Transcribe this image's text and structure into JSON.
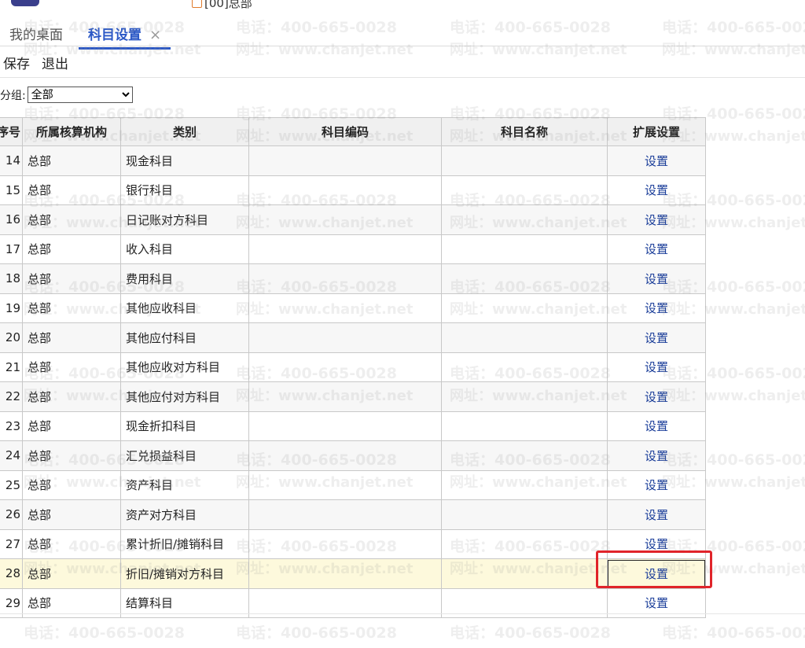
{
  "header": {
    "org_label": "[00]总部"
  },
  "tabs": [
    {
      "label": "我的桌面"
    },
    {
      "label": "科目设置",
      "close": "×"
    }
  ],
  "toolbar": {
    "save": "保存",
    "exit": "退出"
  },
  "filter": {
    "label": "分组:",
    "selected": "全部"
  },
  "table": {
    "columns": [
      "序号",
      "所属核算机构",
      "类别",
      "科目编码",
      "科目名称",
      "扩展设置"
    ],
    "rows": [
      {
        "no": "14",
        "org": "总部",
        "type": "现金科目",
        "code": "",
        "name": "",
        "action": "设置"
      },
      {
        "no": "15",
        "org": "总部",
        "type": "银行科目",
        "code": "",
        "name": "",
        "action": "设置"
      },
      {
        "no": "16",
        "org": "总部",
        "type": "日记账对方科目",
        "code": "",
        "name": "",
        "action": "设置"
      },
      {
        "no": "17",
        "org": "总部",
        "type": "收入科目",
        "code": "",
        "name": "",
        "action": "设置"
      },
      {
        "no": "18",
        "org": "总部",
        "type": "费用科目",
        "code": "",
        "name": "",
        "action": "设置"
      },
      {
        "no": "19",
        "org": "总部",
        "type": "其他应收科目",
        "code": "",
        "name": "",
        "action": "设置"
      },
      {
        "no": "20",
        "org": "总部",
        "type": "其他应付科目",
        "code": "",
        "name": "",
        "action": "设置"
      },
      {
        "no": "21",
        "org": "总部",
        "type": "其他应收对方科目",
        "code": "",
        "name": "",
        "action": "设置"
      },
      {
        "no": "22",
        "org": "总部",
        "type": "其他应付对方科目",
        "code": "",
        "name": "",
        "action": "设置"
      },
      {
        "no": "23",
        "org": "总部",
        "type": "现金折扣科目",
        "code": "",
        "name": "",
        "action": "设置"
      },
      {
        "no": "24",
        "org": "总部",
        "type": "汇兑损益科目",
        "code": "",
        "name": "",
        "action": "设置"
      },
      {
        "no": "25",
        "org": "总部",
        "type": "资产科目",
        "code": "",
        "name": "",
        "action": "设置"
      },
      {
        "no": "26",
        "org": "总部",
        "type": "资产对方科目",
        "code": "",
        "name": "",
        "action": "设置"
      },
      {
        "no": "27",
        "org": "总部",
        "type": "累计折旧/摊销科目",
        "code": "",
        "name": "",
        "action": "设置"
      },
      {
        "no": "28",
        "org": "总部",
        "type": "折旧/摊销对方科目",
        "code": "",
        "name": "",
        "action": "设置"
      },
      {
        "no": "29",
        "org": "总部",
        "type": "结算科目",
        "code": "",
        "name": "",
        "action": "设置"
      }
    ]
  },
  "watermark": {
    "phone": "电话：400-665-0028",
    "site": "网址：www.chanjet.net"
  },
  "colors": {
    "tab_active": "#2b58c6",
    "link": "#1a3d99",
    "highlight_row": "#fdf9dc",
    "annotation": "#e0242a"
  }
}
